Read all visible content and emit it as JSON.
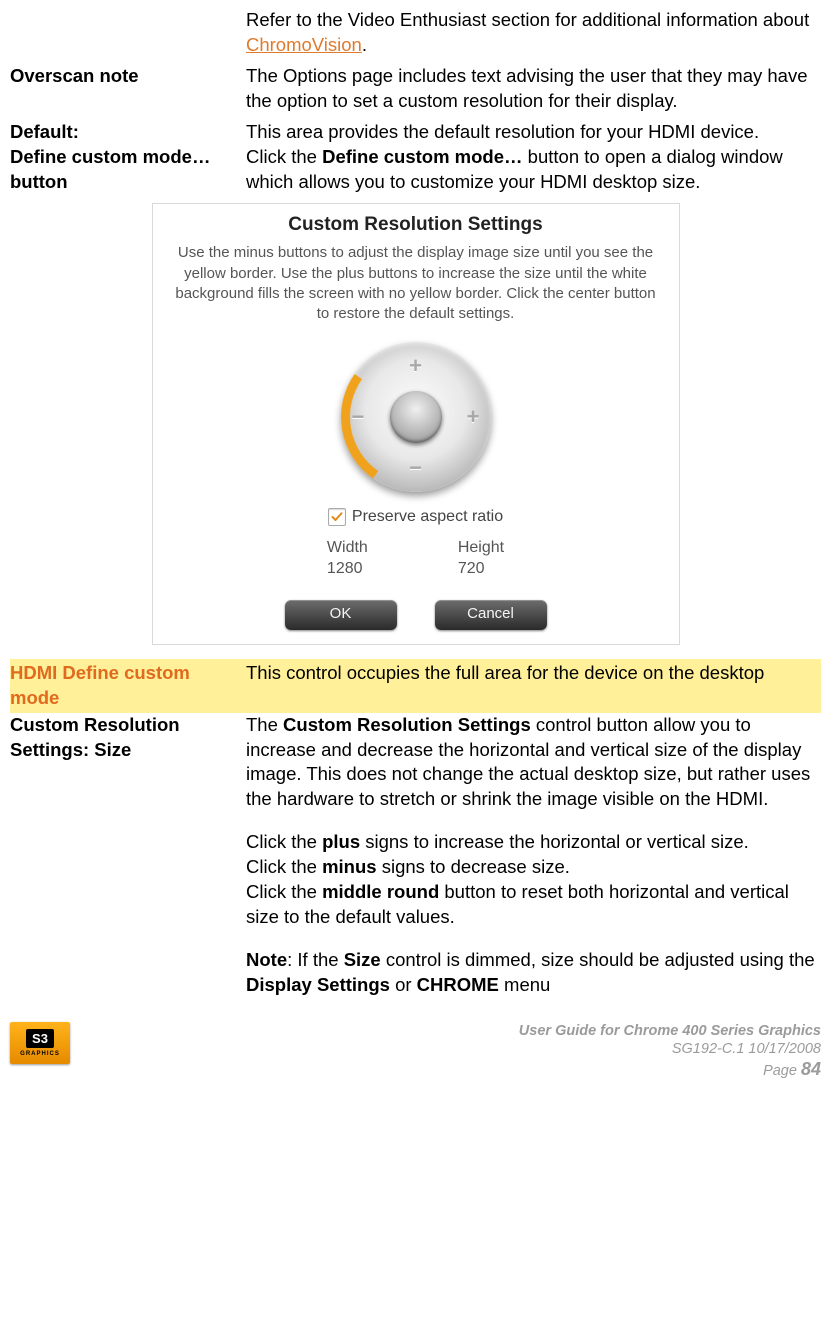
{
  "intro": {
    "refer_pre": "Refer to the Video Enthusiast section for additional information about ",
    "refer_link": "ChromoVision",
    "refer_post": "."
  },
  "rows": {
    "overscan": {
      "label": "Overscan note",
      "body": "The Options page includes text advising the user that they may have the option to set a custom resolution for their display."
    },
    "default": {
      "label": "Default:",
      "body": "This area provides the default resolution for your HDMI device."
    },
    "define": {
      "label": "Define custom mode… button",
      "body_pre": "Click the ",
      "body_bold": "Define custom mode…",
      "body_post": " button to open a dialog window which allows you to customize your HDMI desktop size."
    },
    "hl": {
      "label": "HDMI Define custom mode",
      "body": "This control occupies the full area for the device on the desktop"
    },
    "crs": {
      "label": "Custom Resolution Settings: Size",
      "p1_pre": "The ",
      "p1_b1": "Custom Resolution Settings",
      "p1_post": " control button allow you to increase and decrease the horizontal and vertical size of the display image. This does not change the actual desktop size, but rather uses the hardware to stretch or shrink the image visible on the HDMI.",
      "p2_pre": "Click the ",
      "p2_b": "plus",
      "p2_post": " signs to increase the horizontal or vertical size.",
      "p3_pre": "Click the ",
      "p3_b": "minus",
      "p3_post": " signs to decrease size.",
      "p4_pre": "Click the ",
      "p4_b": "middle round",
      "p4_post": " button to reset both horizontal and vertical size to the default values.",
      "note_b1": "Note",
      "note_mid1": ": If the ",
      "note_b2": "Size",
      "note_mid2": " control is dimmed, size should be adjusted using the ",
      "note_b3": "Display Settings",
      "note_mid3": " or ",
      "note_b4": "CHROME",
      "note_post": " menu"
    }
  },
  "dialog": {
    "title": "Custom Resolution Settings",
    "help": "Use the minus buttons to adjust the display image size until you see the yellow border. Use the plus buttons to increase the size until the white background fills the screen with no yellow border. Click the center button to restore the default settings.",
    "dpad": {
      "plus": "+",
      "minus": "−"
    },
    "preserve": "Preserve aspect ratio",
    "width_lbl": "Width",
    "width_val": "1280",
    "height_lbl": "Height",
    "height_val": "720",
    "ok": "OK",
    "cancel": "Cancel"
  },
  "footer": {
    "logo_main": "S3",
    "logo_sub": "GRAPHICS",
    "title": "User Guide for Chrome 400 Series Graphics",
    "doc": "SG192-C.1   10/17/2008",
    "page_lbl": "Page ",
    "page_num": "84"
  }
}
